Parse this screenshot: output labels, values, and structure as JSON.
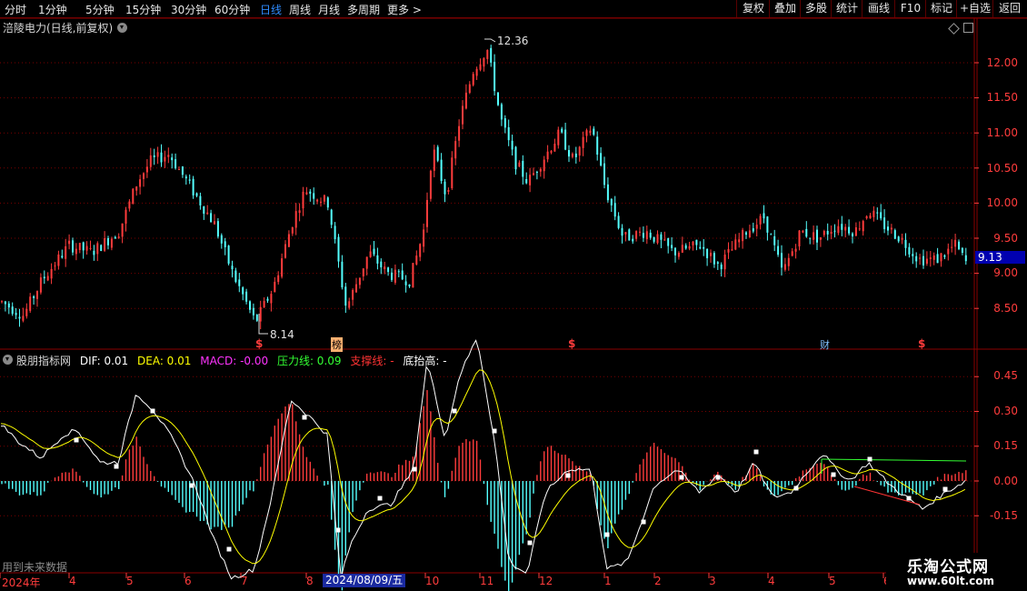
{
  "toolbar": {
    "periods": [
      "分时",
      "1分钟",
      "5分钟",
      "15分钟",
      "30分钟",
      "60分钟",
      "日线",
      "周线",
      "月线",
      "多周期",
      "更多 >"
    ],
    "active_period": "日线",
    "buttons": [
      "复权",
      "叠加",
      "多股",
      "统计",
      "画线",
      "F10",
      "标记",
      "+自选",
      "返回"
    ]
  },
  "stock": {
    "title": "涪陵电力(日线,前复权)"
  },
  "price_axis": {
    "labels": [
      "12.00",
      "11.50",
      "11.00",
      "10.50",
      "10.00",
      "9.50",
      "9.00",
      "8.50"
    ],
    "current": "9.13"
  },
  "annotations": {
    "high": "12.36",
    "low": "8.14",
    "markers": [
      "$",
      "榜",
      "$",
      "财",
      "$"
    ]
  },
  "indicator": {
    "name": "股朋指标网",
    "dif": "DIF: 0.01",
    "dea": "DEA: 0.01",
    "macd": "MACD: -0.00",
    "pressure": "压力线: 0.09",
    "support": "支撑线: -",
    "bottom": "底抬高: -",
    "axis_labels": [
      "0.45",
      "0.30",
      "0.15",
      "0.00",
      "-0.15"
    ]
  },
  "date_axis": {
    "labels": [
      "2024年",
      "4",
      "5",
      "6",
      "7",
      "8",
      "10",
      "11",
      "12",
      "1",
      "2",
      "3",
      "4",
      "5",
      "6"
    ],
    "highlight": "2024/08/09/五"
  },
  "notice": "用到未来数据",
  "watermark": {
    "line1": "乐淘公式网",
    "line2": "www.60lt.com"
  },
  "colors": {
    "up": "#ff3c3c",
    "down": "#54ffff",
    "dif": "#ffffff",
    "dea": "#ffff00",
    "macd": "#ff33ff",
    "pressure": "#33ff33",
    "support": "#ff3333",
    "border": "#8b0000"
  }
}
